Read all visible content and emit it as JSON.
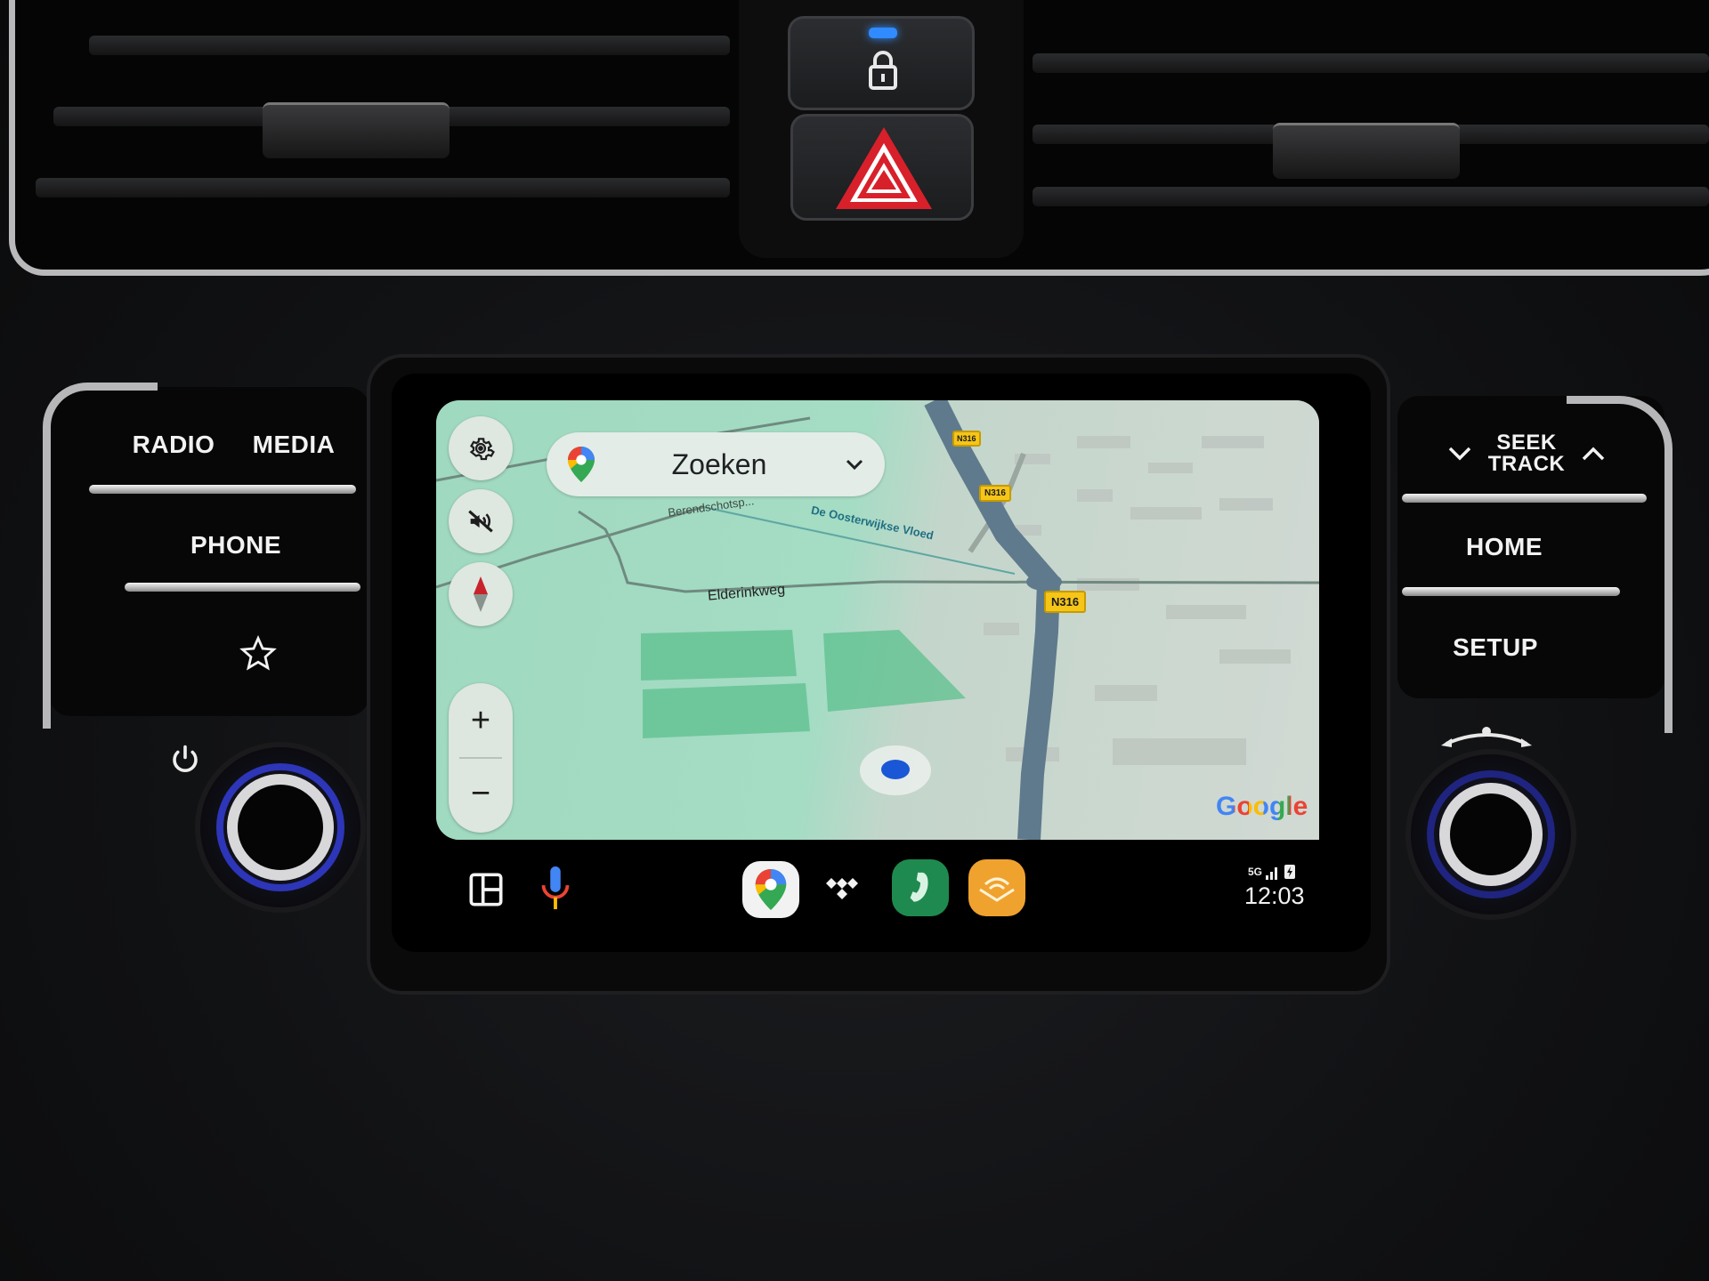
{
  "dashboard": {
    "hazard_controls": {
      "lock_indicator_color": "#2f8bff",
      "lock_icon": "padlock-icon",
      "hazard_icon": "warning-triangle-icon",
      "hazard_color": "#d8202a"
    },
    "left_buttons": {
      "radio_label": "RADIO",
      "media_label": "MEDIA",
      "phone_label": "PHONE",
      "favorite_icon": "star-icon",
      "power_icon": "power-icon"
    },
    "right_buttons": {
      "seek_track_line1": "SEEK",
      "seek_track_line2": "TRACK",
      "seek_down_icon": "chevron-down-icon",
      "seek_up_icon": "chevron-up-icon",
      "home_label": "HOME",
      "setup_label": "SETUP",
      "tune_knob_icon": "rotate-arrows-icon"
    }
  },
  "screen": {
    "map": {
      "search": {
        "label": "Zoeken",
        "logo": "google-maps-pin-icon",
        "dropdown_icon": "chevron-down-icon"
      },
      "controls": {
        "settings_icon": "gear-icon",
        "mute_icon": "voice-off-icon",
        "compass_icon": "compass-icon",
        "zoom_in": "+",
        "zoom_out": "−"
      },
      "labels": {
        "road1": "Berendschotsp...",
        "waterway": "De Oosterwijkse Vloed",
        "road2": "Elderinkweg",
        "route_shield_top": "N316",
        "route_shield_mid": "N316",
        "route_shield_main": "N316"
      },
      "attribution": "Google",
      "location_dot_color": "#1a57d6",
      "accent_park_color": "#5cc08d"
    },
    "taskbar": {
      "layout_icon": "split-screen-icon",
      "mic_icon": "microphone-icon",
      "apps": [
        {
          "name": "Google Maps",
          "icon": "google-maps-icon",
          "color": "#f2f2f2"
        },
        {
          "name": "TIDAL",
          "icon": "tidal-icon",
          "color": "#000000"
        },
        {
          "name": "Phone",
          "icon": "phone-icon",
          "color": "#1e8a4f"
        },
        {
          "name": "Audible",
          "icon": "audible-icon",
          "color": "#f0a22e"
        }
      ],
      "status": {
        "network": "5G",
        "signal_icon": "signal-bars-icon",
        "battery_icon": "battery-charging-icon",
        "time": "12:03"
      }
    }
  }
}
